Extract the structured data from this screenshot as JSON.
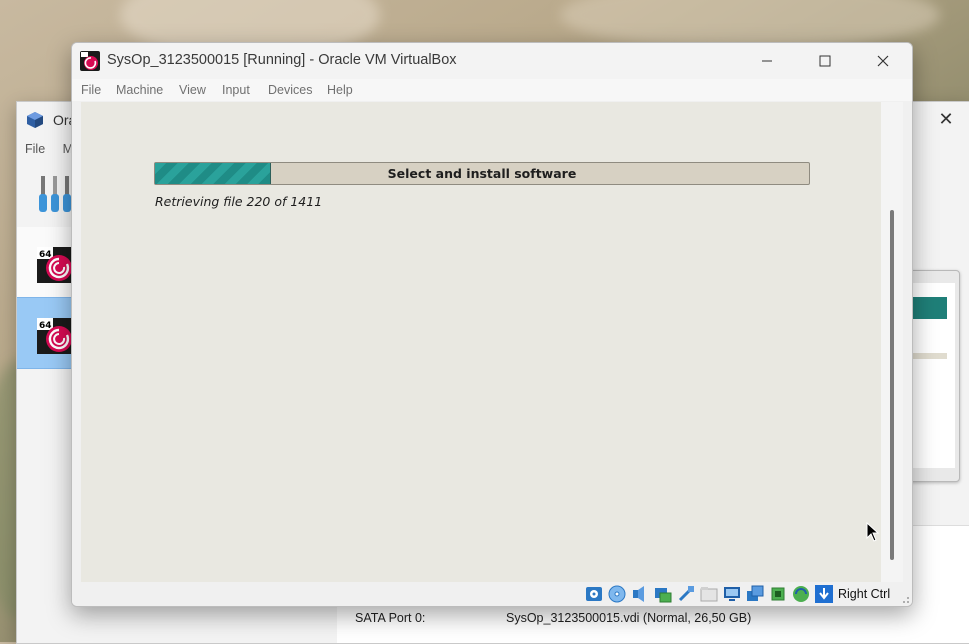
{
  "manager_window": {
    "title": "Ora",
    "menu": [
      "File",
      "M"
    ],
    "storage": {
      "port_label": "SATA Port 0:",
      "port_value": "SysOp_3123500015.vdi (Normal, 26,50 GB)"
    },
    "vm_items": [
      {
        "badge": "64",
        "selected": false
      },
      {
        "badge": "64",
        "selected": true
      }
    ],
    "close_icon": "close-icon"
  },
  "vm_window": {
    "title": "SysOp_3123500015 [Running] - Oracle VM VirtualBox",
    "menu": [
      "File",
      "Machine",
      "View",
      "Input",
      "Devices",
      "Help"
    ],
    "controls": [
      "minimize-icon",
      "maximize-icon",
      "close-icon"
    ],
    "guest": {
      "progress": {
        "label": "Select and install software",
        "fraction": 0.176
      },
      "status": "Retrieving file 220 of 1411"
    },
    "statusbar": {
      "icons": [
        "hard-disk-icon",
        "optical-disk-icon",
        "audio-icon",
        "network-icon",
        "usb-icon",
        "shared-folders-icon",
        "display-icon",
        "video-capture-icon",
        "cpu-icon",
        "mouse-integration-icon",
        "keyboard-icon"
      ],
      "host_key": "Right Ctrl"
    }
  },
  "colors": {
    "progress_fill": "#2aa29b",
    "progress_track": "#d7d1c3",
    "guest_background": "#e9e8e1",
    "selection": "#99c9f5"
  }
}
